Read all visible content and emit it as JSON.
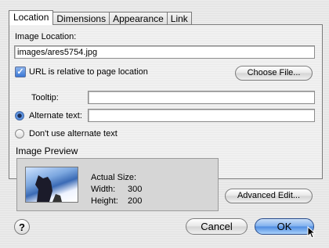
{
  "tabs": [
    "Location",
    "Dimensions",
    "Appearance",
    "Link"
  ],
  "location": {
    "image_location_label": "Image Location:",
    "image_location_value": "images/ares5754.jpg",
    "relative_checkbox_label": "URL is relative to page location",
    "relative_checked": true,
    "choose_file_label": "Choose File...",
    "tooltip_label": "Tooltip:",
    "tooltip_value": "",
    "alternate_text_label": "Alternate text:",
    "alternate_text_value": "",
    "alternate_selected": true,
    "no_alt_label": "Don't use alternate text"
  },
  "preview": {
    "heading": "Image Preview",
    "actual_size_label": "Actual Size:",
    "width_label": "Width:",
    "width_value": "300",
    "height_label": "Height:",
    "height_value": "200"
  },
  "buttons": {
    "advanced_edit": "Advanced Edit...",
    "help": "?",
    "cancel": "Cancel",
    "ok": "OK"
  }
}
